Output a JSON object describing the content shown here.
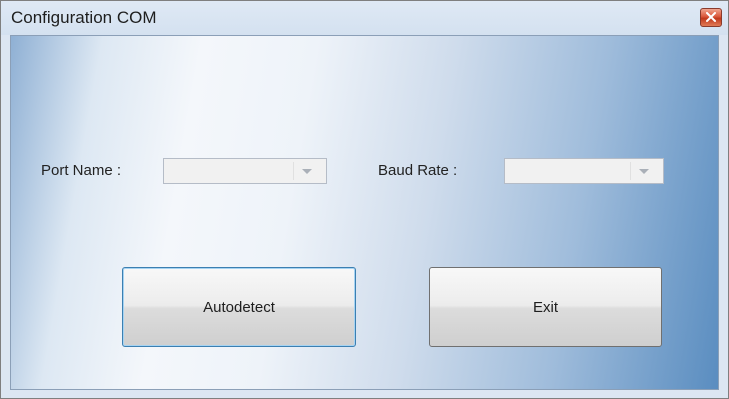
{
  "window": {
    "title": "Configuration COM"
  },
  "form": {
    "port_name_label": "Port Name :",
    "port_name_value": "",
    "baud_rate_label": "Baud Rate :",
    "baud_rate_value": ""
  },
  "buttons": {
    "autodetect_label": "Autodetect",
    "exit_label": "Exit"
  },
  "colors": {
    "close_button": "#d9573a",
    "focus_border": "#3c7fb1"
  },
  "icons": {
    "close": "close-icon",
    "dropdown": "chevron-down-icon"
  }
}
